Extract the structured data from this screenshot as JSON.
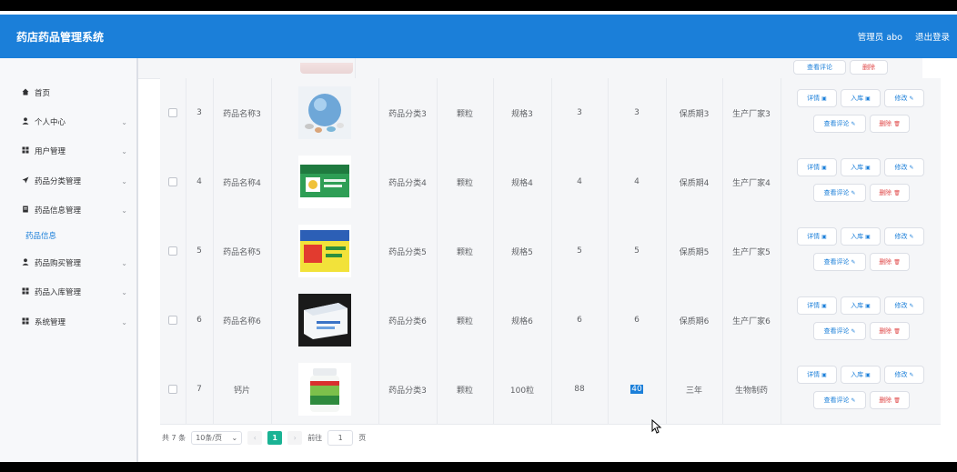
{
  "app": {
    "title": "药店药品管理系统"
  },
  "header": {
    "user": "管理员 abo",
    "logout": "退出登录"
  },
  "sidebar": {
    "items": [
      {
        "label": "首页",
        "icon": "home-icon",
        "has_arrow": false
      },
      {
        "label": "个人中心",
        "icon": "user-icon",
        "has_arrow": true
      },
      {
        "label": "用户管理",
        "icon": "grid-icon",
        "has_arrow": true
      },
      {
        "label": "药品分类管理",
        "icon": "send-icon",
        "has_arrow": true
      },
      {
        "label": "药品信息管理",
        "icon": "doc-icon",
        "has_arrow": true
      },
      {
        "label": "药品购买管理",
        "icon": "user-icon",
        "has_arrow": true
      },
      {
        "label": "药品入库管理",
        "icon": "grid-icon",
        "has_arrow": true
      },
      {
        "label": "系统管理",
        "icon": "grid-icon",
        "has_arrow": true
      }
    ],
    "sub_item": "药品信息"
  },
  "table": {
    "buttons": {
      "detail": "详情",
      "in": "入库",
      "edit": "修改",
      "review": "查看评论",
      "del": "删除"
    },
    "rows": [
      {
        "id": "3",
        "name": "药品名称3",
        "category": "药品分类3",
        "form": "颗粒",
        "spec": "规格3",
        "price": "3",
        "stock": "3",
        "shelf": "保质期3",
        "maker": "生产厂家3",
        "img": "globe-pills"
      },
      {
        "id": "4",
        "name": "药品名称4",
        "category": "药品分类4",
        "form": "颗粒",
        "spec": "规格4",
        "price": "4",
        "stock": "4",
        "shelf": "保质期4",
        "maker": "生产厂家4",
        "img": "green-box"
      },
      {
        "id": "5",
        "name": "药品名称5",
        "category": "药品分类5",
        "form": "颗粒",
        "spec": "规格5",
        "price": "5",
        "stock": "5",
        "shelf": "保质期5",
        "maker": "生产厂家5",
        "img": "yellow-box"
      },
      {
        "id": "6",
        "name": "药品名称6",
        "category": "药品分类6",
        "form": "颗粒",
        "spec": "规格6",
        "price": "6",
        "stock": "6",
        "shelf": "保质期6",
        "maker": "生产厂家6",
        "img": "white-box"
      },
      {
        "id": "7",
        "name": "钙片",
        "category": "药品分类3",
        "form": "颗粒",
        "spec": "100粒",
        "price": "88",
        "stock": "40",
        "shelf": "三年",
        "maker": "生物制药",
        "img": "bottle"
      }
    ]
  },
  "pager": {
    "total": "共 7 条",
    "page_size": "10条/页",
    "current": "1",
    "goto": "前往",
    "goto_value": "1",
    "page_unit": "页"
  },
  "colors": {
    "header": "#1b7fd9",
    "accent": "#1b7fd9",
    "danger": "#e04a4a",
    "pager_current": "#1ab394"
  }
}
